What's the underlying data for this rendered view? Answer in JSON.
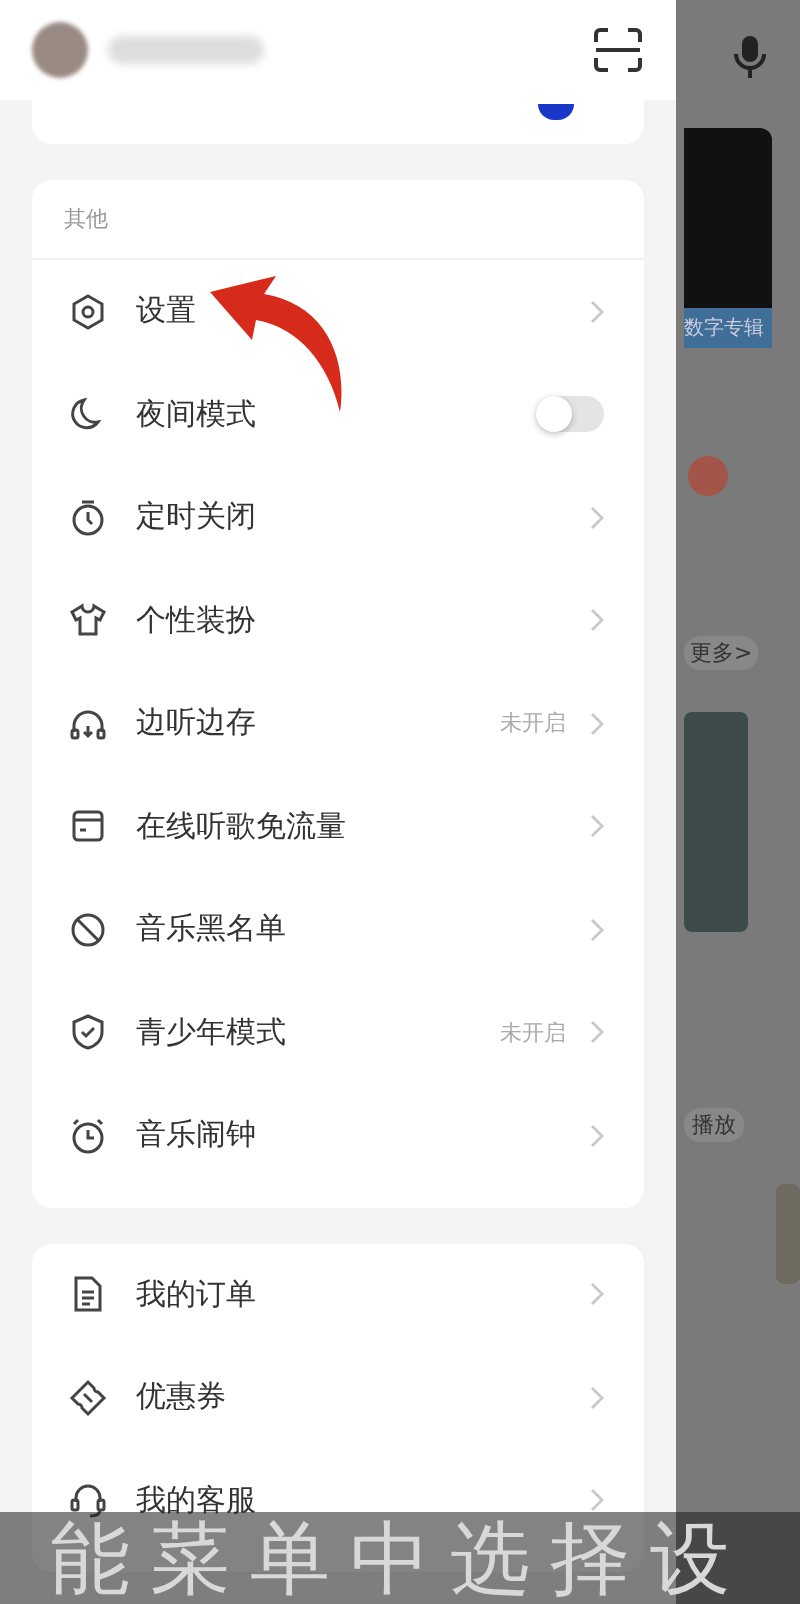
{
  "drawer": {
    "section_title": "其他",
    "items": [
      {
        "kind": "link",
        "label": "设置"
      },
      {
        "kind": "toggle",
        "label": "夜间模式",
        "on": false
      },
      {
        "kind": "link",
        "label": "定时关闭"
      },
      {
        "kind": "link",
        "label": "个性装扮"
      },
      {
        "kind": "link",
        "label": "边听边存",
        "status": "未开启"
      },
      {
        "kind": "link",
        "label": "在线听歌免流量"
      },
      {
        "kind": "link",
        "label": "音乐黑名单"
      },
      {
        "kind": "link",
        "label": "青少年模式",
        "status": "未开启"
      },
      {
        "kind": "link",
        "label": "音乐闹钟"
      }
    ],
    "items2": [
      {
        "kind": "link",
        "label": "我的订单"
      },
      {
        "kind": "link",
        "label": "优惠券"
      },
      {
        "kind": "link",
        "label": "我的客服"
      }
    ]
  },
  "background": {
    "album_label": "数字专辑",
    "more": "更多>",
    "play": "播放"
  },
  "subtitle": "能菜单中选择设"
}
